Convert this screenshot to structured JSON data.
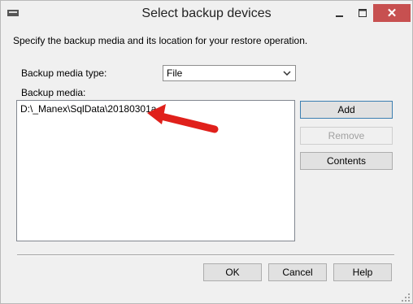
{
  "window": {
    "title": "Select backup devices",
    "controls": {
      "minimize_icon": "minimize-icon",
      "maximize_icon": "maximize-icon",
      "close_label": "✕"
    }
  },
  "description": "Specify the backup media and its location for your restore operation.",
  "backup_media_type": {
    "label": "Backup media type:",
    "selected": "File",
    "options": [
      "File"
    ]
  },
  "backup_media": {
    "label": "Backup media:",
    "items": [
      "D:\\_Manex\\SqlData\\20180301a"
    ]
  },
  "buttons": {
    "add": "Add",
    "remove": "Remove",
    "contents": "Contents",
    "ok": "OK",
    "cancel": "Cancel",
    "help": "Help"
  },
  "annotation": {
    "icon": "red-arrow-annotation",
    "color": "#e0201b"
  }
}
